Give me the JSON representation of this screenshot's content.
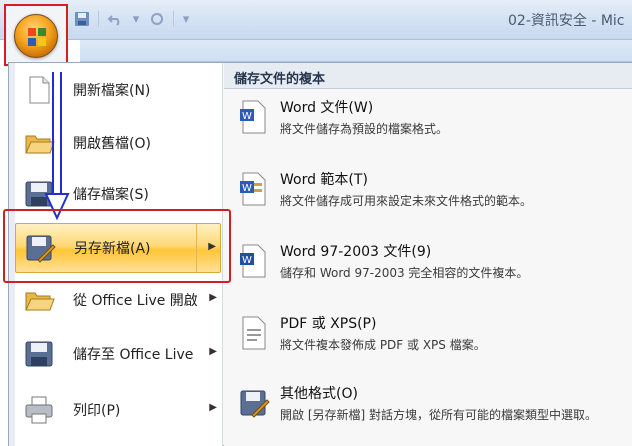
{
  "window": {
    "title": "02-資訊安全 - Mic"
  },
  "quick_access": [
    {
      "icon": "save-icon"
    },
    {
      "icon": "undo-icon"
    },
    {
      "icon": "undo-dropdown-icon"
    },
    {
      "icon": "redo-icon"
    },
    {
      "icon": "customize-toolbar-icon"
    }
  ],
  "office_button": {
    "icon": "office-orb-icon"
  },
  "menu": {
    "items": [
      {
        "label": "開新檔案(N)",
        "icon": "new-document-icon",
        "submenu": false
      },
      {
        "label": "開啟舊檔(O)",
        "icon": "open-folder-icon",
        "submenu": false
      },
      {
        "label": "儲存檔案(S)",
        "icon": "save-icon",
        "submenu": false
      },
      {
        "label": "另存新檔(A)",
        "icon": "save-as-icon",
        "submenu": true,
        "highlighted": true
      },
      {
        "label": "從 Office Live 開啟",
        "icon": "open-folder-icon",
        "submenu": true
      },
      {
        "label": "儲存至 Office Live",
        "icon": "save-icon",
        "submenu": true
      },
      {
        "label": "列印(P)",
        "icon": "print-icon",
        "submenu": true
      }
    ]
  },
  "submenu": {
    "header": "儲存文件的複本",
    "items": [
      {
        "title": "Word 文件(W)",
        "desc": "將文件儲存為預設的檔案格式。",
        "icon": "word-document-icon"
      },
      {
        "title": "Word 範本(T)",
        "desc": "將文件儲存成可用來設定未來文件格式的範本。",
        "icon": "word-template-icon"
      },
      {
        "title": "Word 97-2003 文件(9)",
        "desc": "儲存和 Word 97-2003 完全相容的文件複本。",
        "icon": "word-97-2003-icon"
      },
      {
        "title": "PDF 或 XPS(P)",
        "desc": "將文件複本發佈成 PDF 或 XPS 檔案。",
        "icon": "pdf-xps-icon"
      },
      {
        "title": "其他格式(O)",
        "desc": "開啟 [另存新檔] 對話方塊，從所有可能的檔案類型中選取。",
        "icon": "other-formats-icon"
      }
    ]
  },
  "colors": {
    "annotation": "#d21f1f",
    "arrow": "#1f2fd0",
    "highlight": "#ffd978"
  }
}
